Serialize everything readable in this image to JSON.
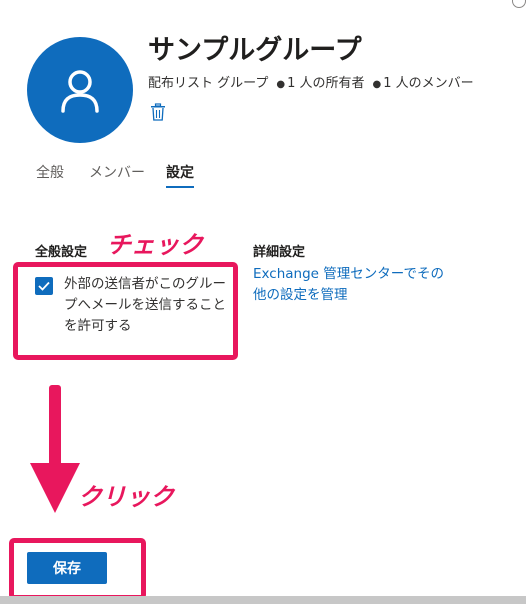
{
  "group": {
    "name": "サンプルグループ",
    "type": "配布リスト グループ",
    "owners": "1 人の所有者",
    "members": "1 人のメンバー",
    "avatar_icon": "person-icon",
    "delete_icon": "trash-icon"
  },
  "tabs": [
    {
      "label": "全般",
      "selected": false
    },
    {
      "label": "メンバー",
      "selected": false
    },
    {
      "label": "設定",
      "selected": true
    }
  ],
  "settings": {
    "general_heading": "全般設定",
    "allow_external_checkbox": {
      "label": "外部の送信者がこのグループへメールを送信することを許可する",
      "checked": true
    },
    "advanced_heading": "詳細設定",
    "exchange_link": "Exchange 管理センターでその他の設定を管理"
  },
  "annotations": {
    "check": "チェック",
    "click": "クリック",
    "color": "#e8175d"
  },
  "footer": {
    "save_label": "保存"
  },
  "colors": {
    "accent": "#0f6cbd",
    "annotation": "#e8175d"
  }
}
